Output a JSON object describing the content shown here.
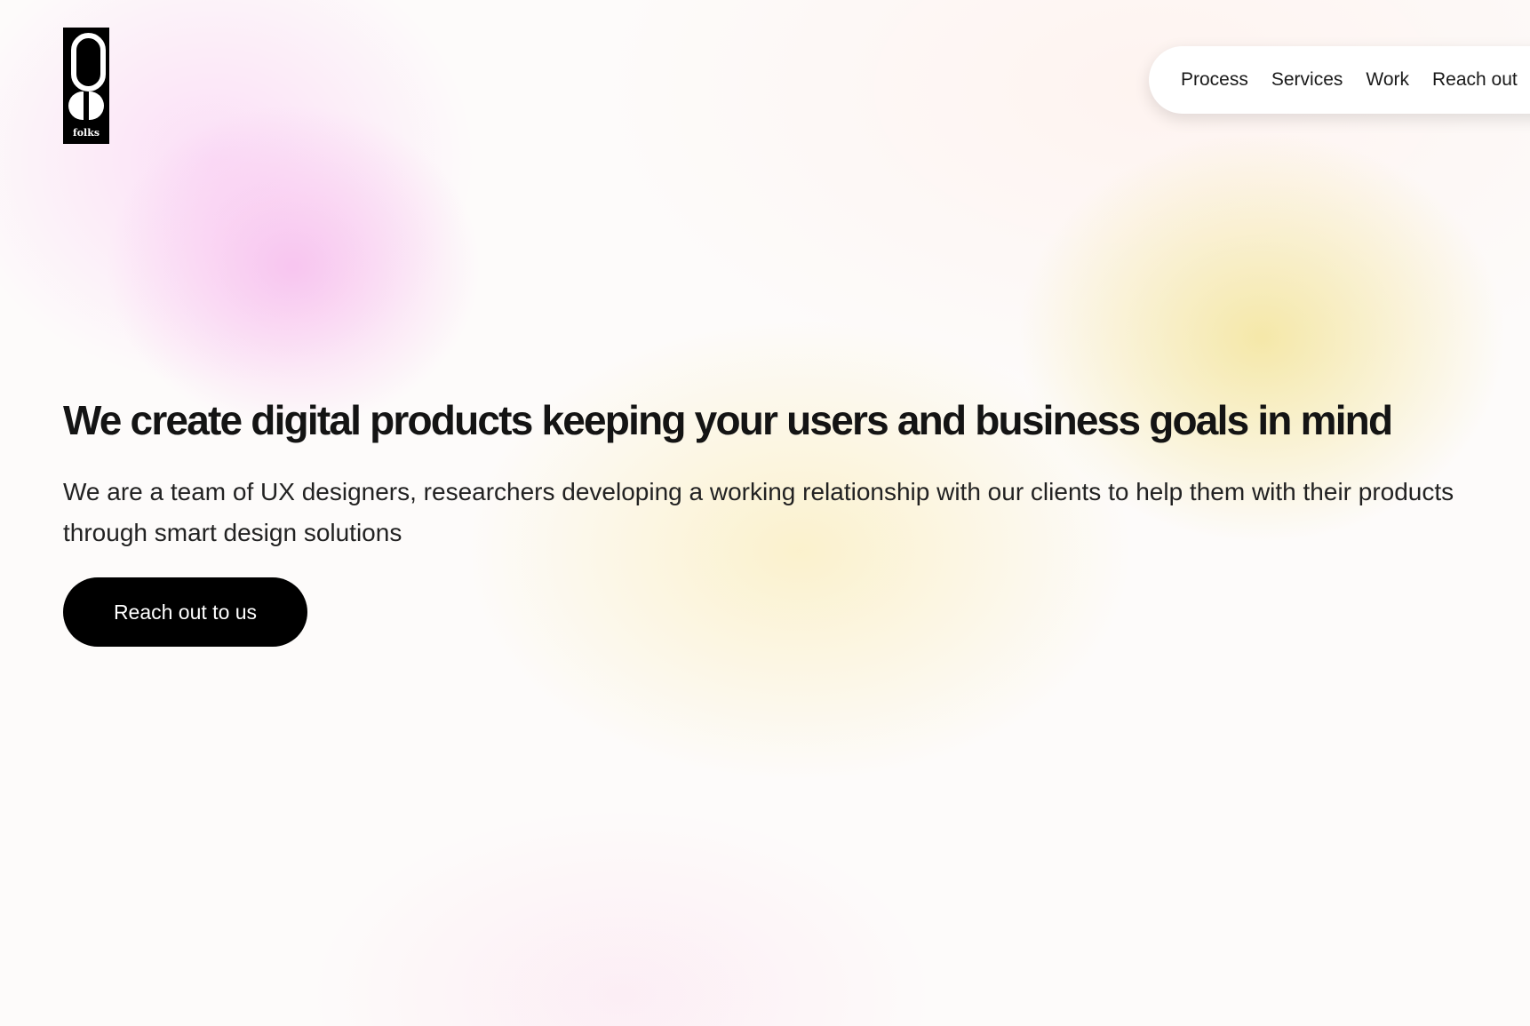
{
  "brand": {
    "logo_text": "folks",
    "logo_icon": "folks-logo-icon"
  },
  "nav": {
    "items": [
      {
        "label": "Process"
      },
      {
        "label": "Services"
      },
      {
        "label": "Work"
      },
      {
        "label": "Reach out"
      }
    ]
  },
  "hero": {
    "headline": "We create digital products keeping your users and business goals in mind",
    "subtext": "We are a team of UX designers, researchers developing a working relationship with our clients to help them with their products through smart design solutions",
    "cta_label": "Reach out to us"
  },
  "colors": {
    "text": "#141414",
    "button_bg": "#000000",
    "button_text": "#ffffff",
    "glow_pink": "#f7beee",
    "glow_yellow": "#f4e6a0"
  }
}
